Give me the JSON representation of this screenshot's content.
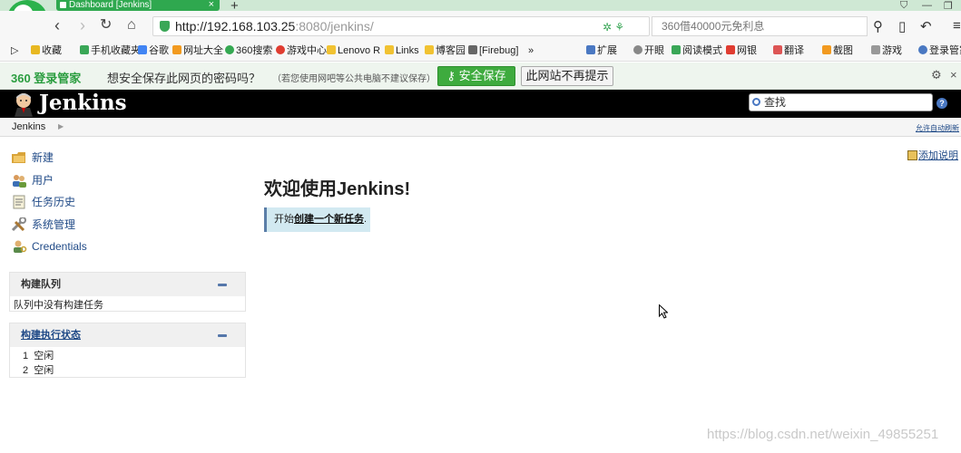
{
  "browser": {
    "tab_title": "Dashboard [Jenkins]",
    "tab_close": "×",
    "new_tab": "+",
    "url_host": "http://192.168.103.25",
    "url_path": ":8080/jenkins/",
    "search_placeholder": "360借40000元免利息",
    "bookmarks": [
      "收藏",
      "手机收藏夹",
      "谷歌",
      "网址大全",
      "360搜索",
      "游戏中心",
      "Lenovo R",
      "Links",
      "博客园",
      "[Firebug]",
      "»",
      "扩展",
      "开眼",
      "阅读模式",
      "网银",
      "翻译",
      "截图",
      "游戏",
      "登录管家"
    ]
  },
  "password_bar": {
    "logo": "360 登录管家",
    "question": "想安全保存此网页的密码吗？",
    "note": "（若您使用网吧等公共电脑不建议保存）",
    "save_label": "安全保存",
    "no_label": "此网站不再提示"
  },
  "jenkins": {
    "title": "Jenkins",
    "search_placeholder": "查找",
    "breadcrumb_root": "Jenkins",
    "auto_refresh": "允许自动刷新",
    "tasks": [
      "新建",
      "用户",
      "任务历史",
      "系统管理",
      "Credentials"
    ],
    "build_queue": {
      "title": "构建队列",
      "empty_text": "队列中没有构建任务"
    },
    "executors": {
      "title": "构建执行状态",
      "rows": [
        {
          "num": "1",
          "status": "空闲"
        },
        {
          "num": "2",
          "status": "空闲"
        }
      ]
    },
    "add_description": "添加说明",
    "welcome": "欢迎使用Jenkins!",
    "create_prefix": "开始",
    "create_link": "创建一个新任务",
    "create_suffix": "."
  },
  "watermark": "https://blog.csdn.net/weixin_49855251"
}
